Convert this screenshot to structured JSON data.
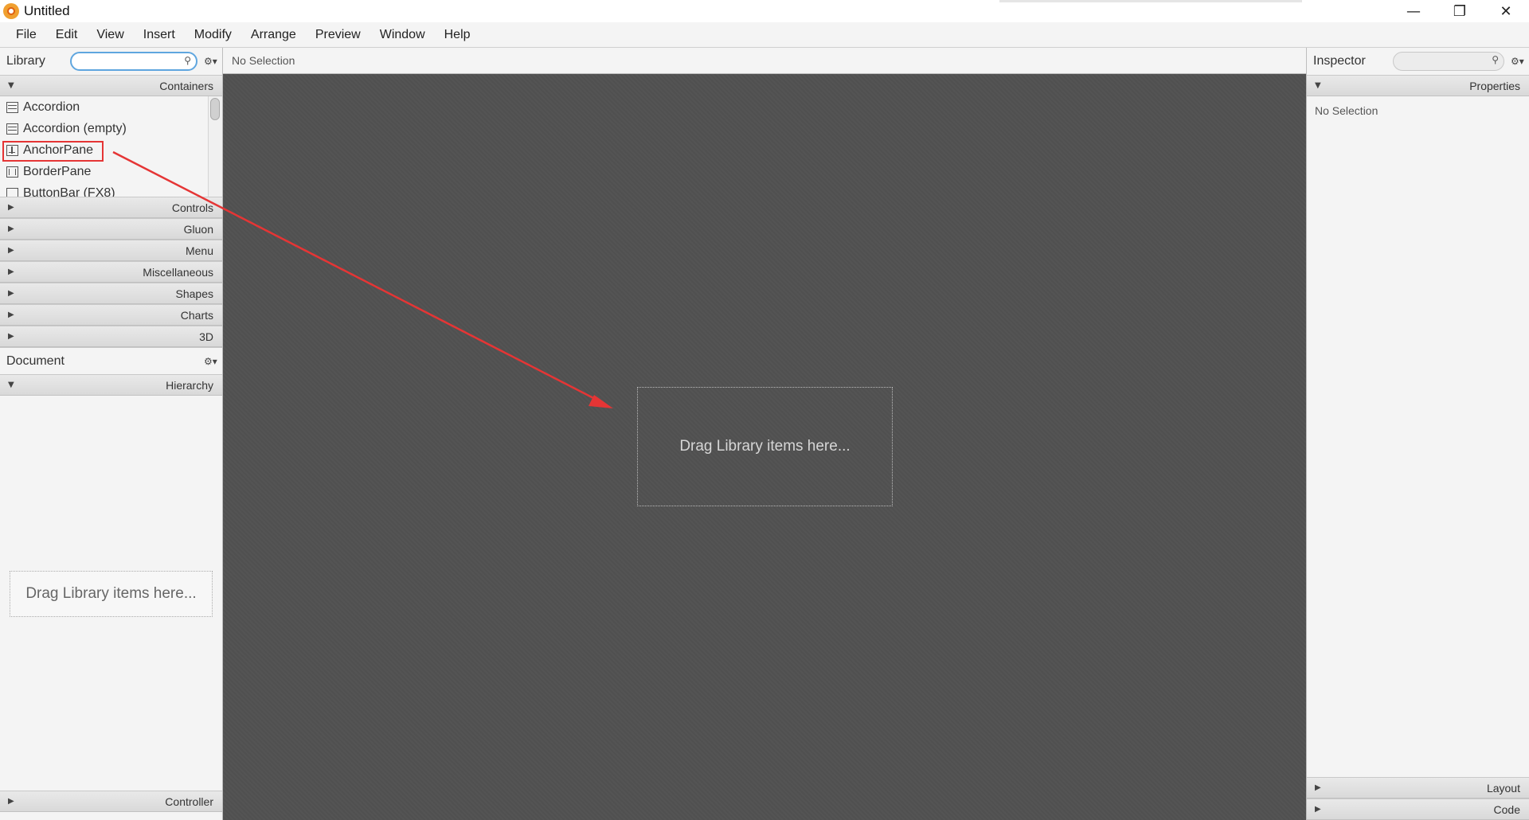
{
  "window": {
    "title": "Untitled",
    "minimize": "—",
    "restore": "❐",
    "close": "✕"
  },
  "menu": [
    "File",
    "Edit",
    "View",
    "Insert",
    "Modify",
    "Arrange",
    "Preview",
    "Window",
    "Help"
  ],
  "library": {
    "title": "Library",
    "search_value": "",
    "sections": {
      "containers": "Containers",
      "collapsed": [
        "Controls",
        "Gluon",
        "Menu",
        "Miscellaneous",
        "Shapes",
        "Charts",
        "3D"
      ]
    },
    "items": [
      "Accordion",
      "Accordion  (empty)",
      "AnchorPane",
      "BorderPane",
      "ButtonBar  (FX8)"
    ],
    "highlighted_item": "AnchorPane"
  },
  "document": {
    "title": "Document",
    "hierarchy": "Hierarchy",
    "drop_hint": "Drag Library items here...",
    "controller": "Controller"
  },
  "canvas": {
    "status": "No Selection",
    "drop_hint": "Drag Library items here..."
  },
  "inspector": {
    "title": "Inspector",
    "search_value": "",
    "properties": "Properties",
    "no_selection": "No Selection",
    "layout": "Layout",
    "code": "Code"
  },
  "annotation": {
    "highlight_color": "#e53535",
    "arrow_color": "#e53535"
  }
}
